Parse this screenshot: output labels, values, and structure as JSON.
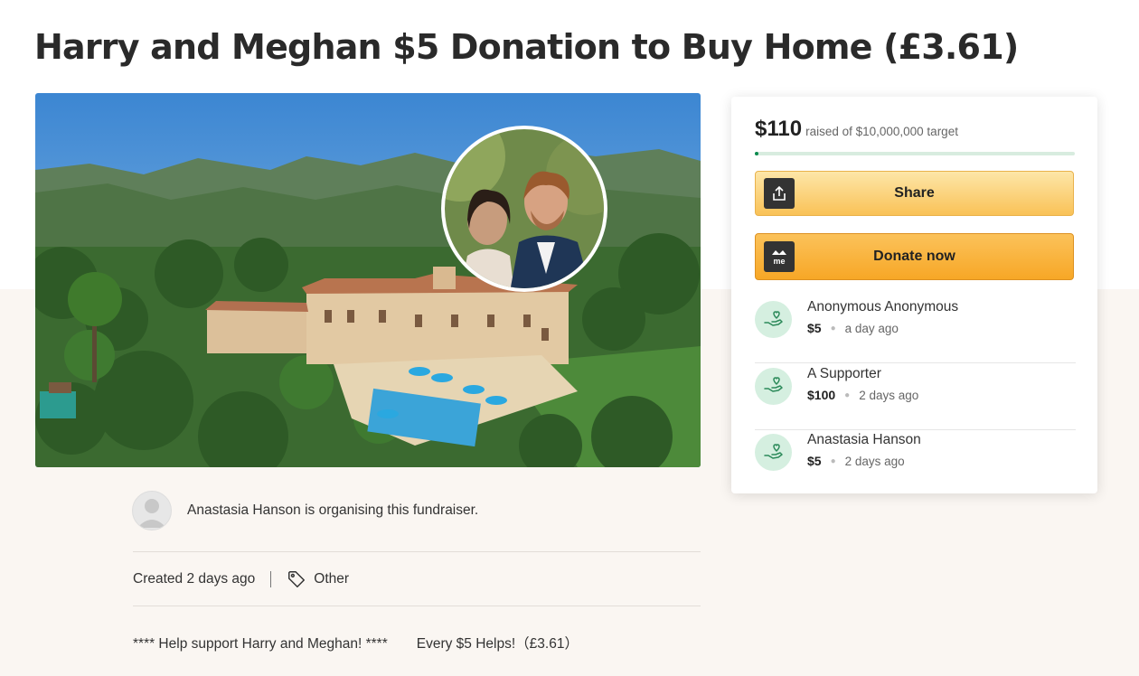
{
  "page": {
    "title": "Harry and Meghan $5 Donation to Buy Home (£3.61)"
  },
  "organiser": {
    "text": "Anastasia Hanson is organising this fundraiser."
  },
  "meta": {
    "created": "Created 2 days ago",
    "category": "Other"
  },
  "description": {
    "part1": "**** Help support Harry and Meghan! ****",
    "part2": "Every $5 Helps!（£3.61）"
  },
  "card": {
    "amount_raised": "$110",
    "target_text": "raised of $10,000,000 target",
    "progress_fraction": 0.011,
    "share_label": "Share",
    "donate_label": "Donate now",
    "donations": [
      {
        "name": "Anonymous Anonymous",
        "amount": "$5",
        "time": "a day ago"
      },
      {
        "name": "A Supporter",
        "amount": "$100",
        "time": "2 days ago"
      },
      {
        "name": "Anastasia Hanson",
        "amount": "$5",
        "time": "2 days ago"
      }
    ]
  },
  "icons": {
    "share": "share-upload-icon",
    "donate": "gofundme-logo-icon",
    "donor": "donor-heart-hand-icon",
    "tag": "tag-icon",
    "avatar": "user-avatar-icon"
  },
  "colors": {
    "progress": "#0a8a4e",
    "share_button": "#f9c257",
    "donate_button": "#f7a726",
    "donor_badge": "#d5efe0",
    "page_bottom_bg": "#faf6f2"
  }
}
